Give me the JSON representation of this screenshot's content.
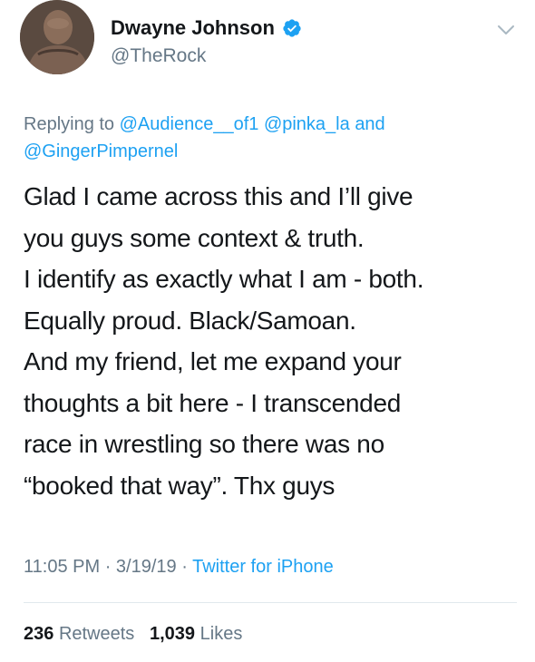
{
  "user": {
    "display_name": "Dwayne Johnson",
    "handle": "@TheRock",
    "verified": true
  },
  "reply": {
    "prefix": "Replying to",
    "mentions": [
      "@Audience__of1",
      "@pinka_la"
    ],
    "conjunction": "and",
    "last_mention": "@GingerPimpernel"
  },
  "tweet": {
    "lines": [
      "Glad I came across this and I’ll give",
      "you guys some context & truth.",
      "I identify as exactly what I am - both.",
      "Equally proud. Black/Samoan.",
      "And my friend, let me expand your",
      "thoughts a bit here - I transcended",
      "race in wrestling so there was no",
      "“booked that way”. Thx guys"
    ]
  },
  "meta": {
    "time": "11:05 PM",
    "date": "3/19/19",
    "separator": "·",
    "source": "Twitter for iPhone"
  },
  "stats": {
    "retweets_count": "236",
    "retweets_label": "Retweets",
    "likes_count": "1,039",
    "likes_label": "Likes"
  },
  "colors": {
    "link": "#1da1f2",
    "secondary_text": "#657786",
    "primary_text": "#14171a",
    "divider": "#e1e8ed"
  },
  "icons": {
    "verified": "verified-badge-icon",
    "menu": "chevron-down-icon"
  }
}
